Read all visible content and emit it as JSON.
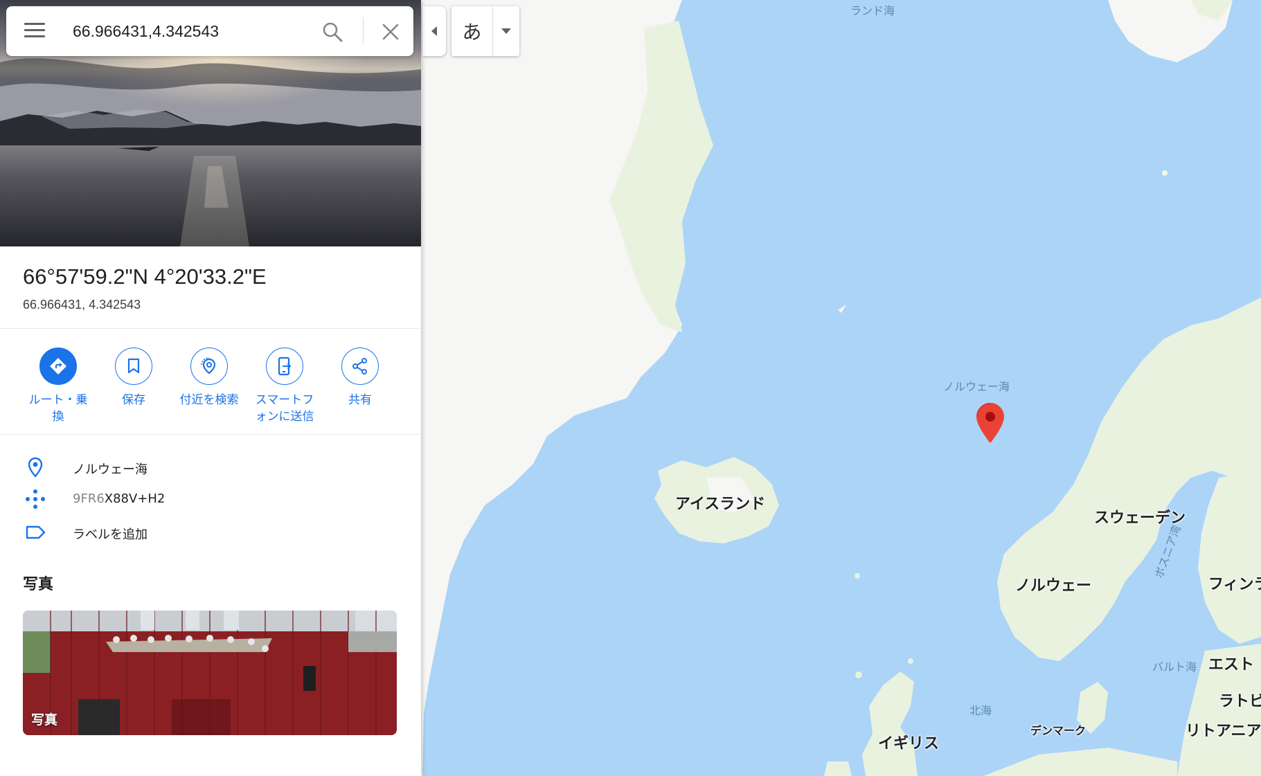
{
  "search": {
    "value": "66.966431,4.342543"
  },
  "place": {
    "title": "66°57'59.2\"N 4°20'33.2\"E",
    "subtitle": "66.966431, 4.342543"
  },
  "actions": [
    {
      "label_line1": "ルート・乗",
      "label_line2": "換",
      "icon": "directions-icon"
    },
    {
      "label_line1": "保存",
      "label_line2": "",
      "icon": "bookmark-icon"
    },
    {
      "label_line1": "付近を検索",
      "label_line2": "",
      "icon": "nearby-icon"
    },
    {
      "label_line1": "スマートフ",
      "label_line2": "ォンに送信",
      "icon": "send-to-phone-icon"
    },
    {
      "label_line1": "共有",
      "label_line2": "",
      "icon": "share-icon"
    }
  ],
  "info": {
    "location": "ノルウェー海",
    "plus_code_prefix": "9FR6",
    "plus_code_rest": "X88V+H2",
    "add_label": "ラベルを追加"
  },
  "photos": {
    "section_title": "写真",
    "card_caption": "写真"
  },
  "ime": {
    "mode": "あ"
  },
  "map": {
    "labels": {
      "greenland_sea": "ランド海",
      "norwegian_sea": "ノルウェー海",
      "iceland": "アイスランド",
      "sweden": "スウェーデン",
      "norway": "ノルウェー",
      "finland": "フィンラ",
      "bothnia": "ボスニア湾",
      "baltic": "バルト海",
      "estonia": "エスト",
      "latvia": "ラトビ",
      "lithuania": "リトアニア",
      "north_sea": "北海",
      "denmark": "デンマーク",
      "uk": "イギリス"
    },
    "colors": {
      "water": "#abd4f7",
      "land": "#e9f2df",
      "ice": "#f6f6f4",
      "pin": "#ea4335",
      "accent": "#1a73e8"
    }
  }
}
